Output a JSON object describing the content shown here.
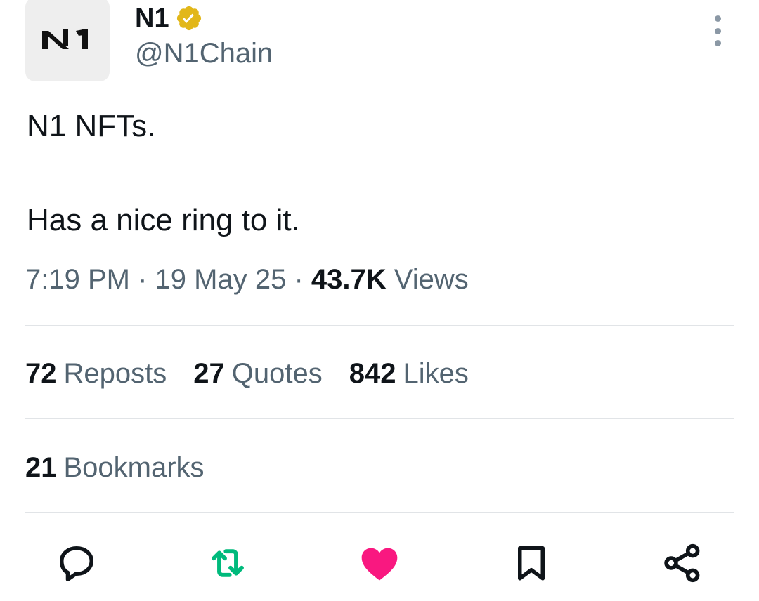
{
  "author": {
    "display_name": "N1",
    "handle": "@N1Chain",
    "verified_badge_icon": "verified-badge-icon",
    "avatar_logo_text": "N1"
  },
  "tweet": {
    "line1": "N1 NFTs.",
    "line2": "Has a nice ring to it."
  },
  "meta": {
    "time": "7:19 PM",
    "separator": "·",
    "date": "19 May 25",
    "views_count": "43.7K",
    "views_label": "Views"
  },
  "stats": {
    "reposts_count": "72",
    "reposts_label": "Reposts",
    "quotes_count": "27",
    "quotes_label": "Quotes",
    "likes_count": "842",
    "likes_label": "Likes",
    "bookmarks_count": "21",
    "bookmarks_label": "Bookmarks"
  },
  "actions": [
    {
      "icon": "reply-icon"
    },
    {
      "icon": "repost-icon"
    },
    {
      "icon": "like-icon"
    },
    {
      "icon": "bookmark-icon"
    },
    {
      "icon": "share-icon"
    }
  ],
  "colors": {
    "repost_active": "#00ba7c",
    "like_active": "#f91880",
    "verified_gold": "#e2b719",
    "secondary_text": "#536471"
  }
}
